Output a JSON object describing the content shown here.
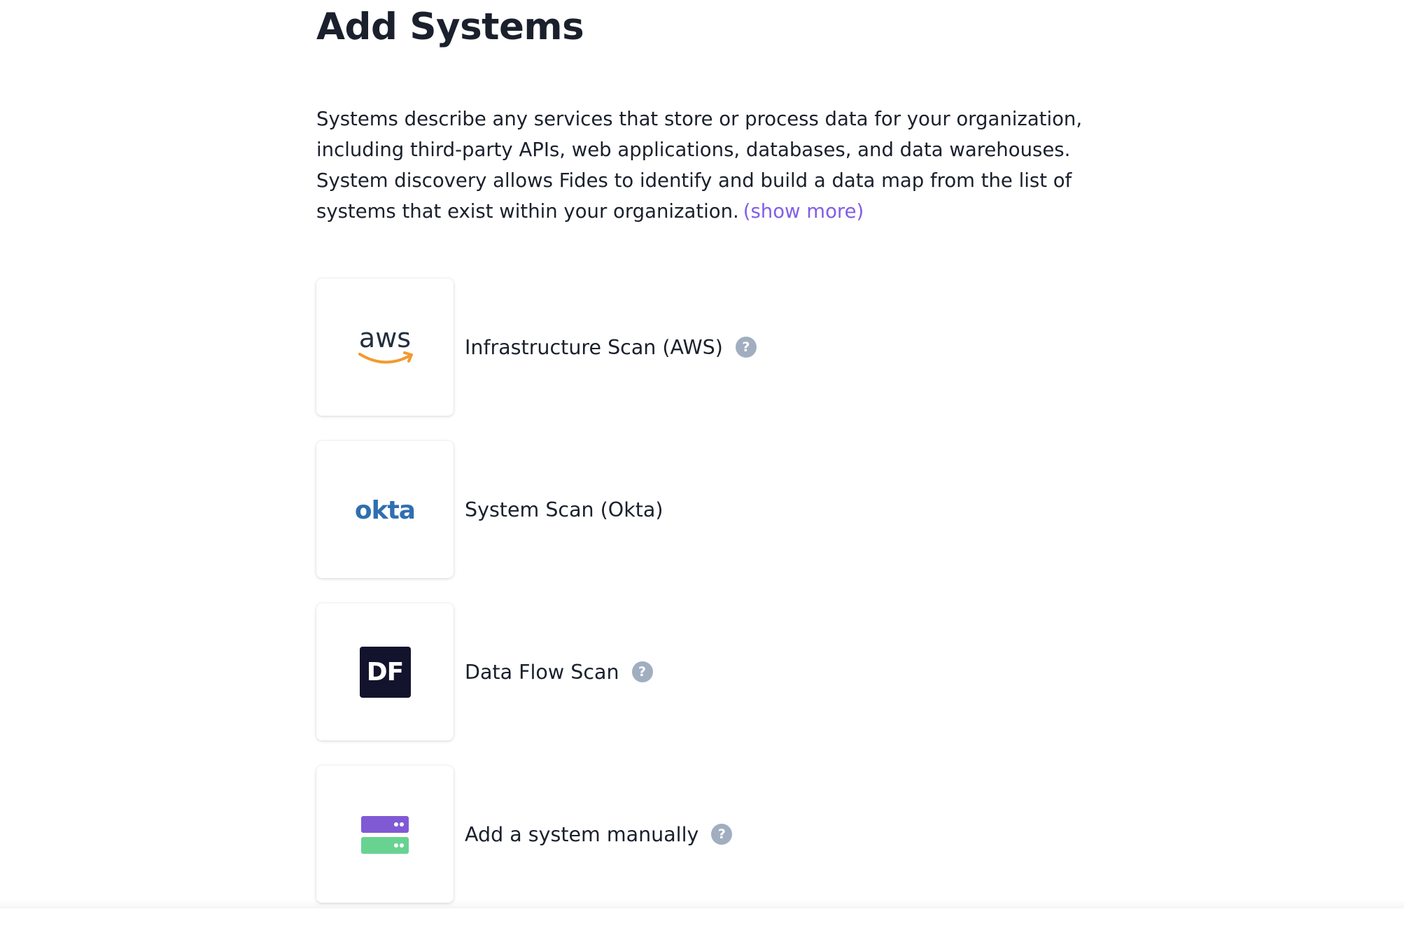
{
  "page": {
    "title": "Add Systems",
    "description": "Systems describe any services that store or process data for your organization, including third-party APIs, web applications, databases, and data warehouses. System discovery allows Fides to identify and build a data map from the list of systems that exist within your organization.",
    "show_more_label": "(show more)",
    "link_color": "#825ee6"
  },
  "options": [
    {
      "label": "Infrastructure Scan (AWS)",
      "icon": "aws-logo-icon",
      "has_help": true,
      "logo_text": "aws"
    },
    {
      "label": "System Scan (Okta)",
      "icon": "okta-logo-icon",
      "has_help": false,
      "logo_text": "okta"
    },
    {
      "label": "Data Flow Scan",
      "icon": "data-flow-logo-icon",
      "has_help": true,
      "logo_text": "DF"
    },
    {
      "label": "Add a system manually",
      "icon": "server-stack-icon",
      "has_help": true
    }
  ],
  "help_icon_glyph": "?",
  "colors": {
    "aws_text": "#232f3e",
    "aws_smile": "#f29a2e",
    "okta_blue": "#2f6fb0",
    "df_background": "#13132e",
    "server_top": "#805ad5",
    "server_bottom": "#68d391",
    "help_icon_bg": "#a0aec0"
  }
}
